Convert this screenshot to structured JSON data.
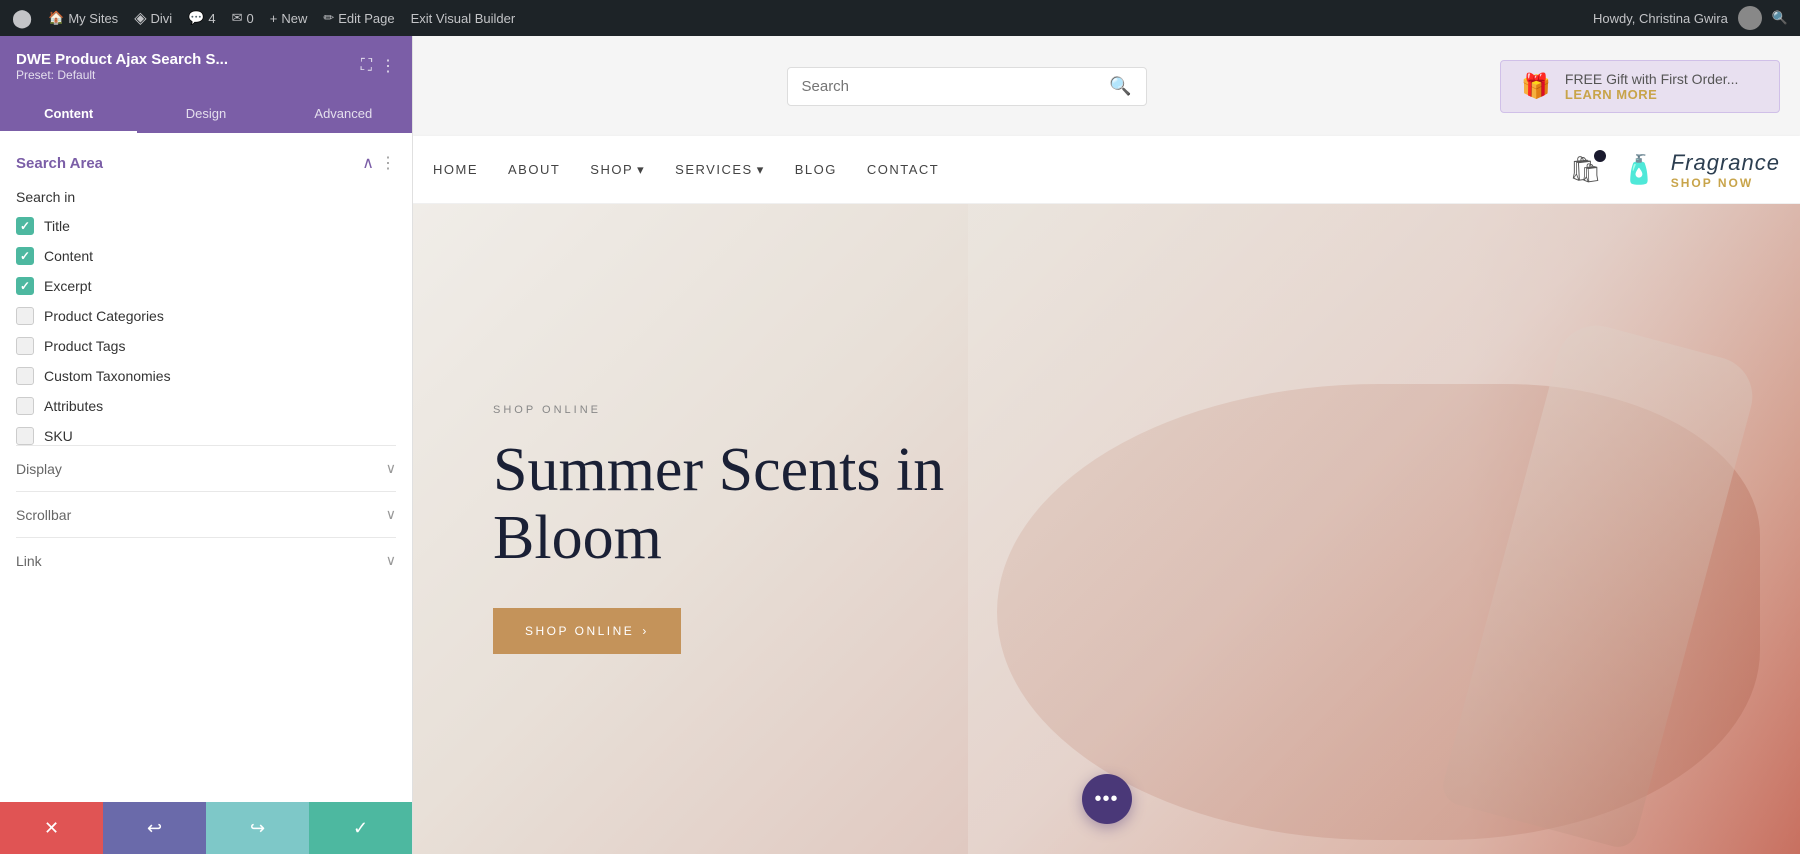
{
  "admin_bar": {
    "wp_label": "WordPress",
    "my_sites": "My Sites",
    "divi": "Divi",
    "comment_count": "4",
    "messages_count": "0",
    "new_label": "New",
    "edit_page_label": "Edit Page",
    "exit_builder_label": "Exit Visual Builder",
    "howdy": "Howdy, Christina Gwira"
  },
  "left_panel": {
    "title": "DWE Product Ajax Search S...",
    "preset_label": "Preset: Default",
    "tabs": [
      "Content",
      "Design",
      "Advanced"
    ],
    "active_tab": "Content",
    "section_title": "Search Area",
    "search_in_label": "Search in",
    "checkboxes": [
      {
        "label": "Title",
        "checked": true
      },
      {
        "label": "Content",
        "checked": true
      },
      {
        "label": "Excerpt",
        "checked": true
      },
      {
        "label": "Product Categories",
        "checked": false
      },
      {
        "label": "Product Tags",
        "checked": false
      },
      {
        "label": "Custom Taxonomies",
        "checked": false
      },
      {
        "label": "Attributes",
        "checked": false
      },
      {
        "label": "SKU",
        "checked": false
      }
    ],
    "collapsible_sections": [
      "Display",
      "Scrollbar",
      "Link"
    ],
    "footer_buttons": {
      "cancel": "✕",
      "undo": "↩",
      "redo": "↪",
      "confirm": "✓"
    }
  },
  "top_bar": {
    "search_placeholder": "Search",
    "promo_main": "FREE Gift with First Order...",
    "promo_link": "LEARN MORE"
  },
  "nav": {
    "links": [
      "HOME",
      "ABOUT",
      "SHOP",
      "SERVICES",
      "BLOG",
      "CONTACT"
    ],
    "fragrance_name": "Fragrance",
    "fragrance_cta": "SHOP NOW"
  },
  "hero": {
    "label": "SHOP ONLINE",
    "title_line1": "Summer Scents in",
    "title_line2": "Bloom",
    "cta_label": "SHOP ONLINE",
    "cta_arrow": "›"
  }
}
